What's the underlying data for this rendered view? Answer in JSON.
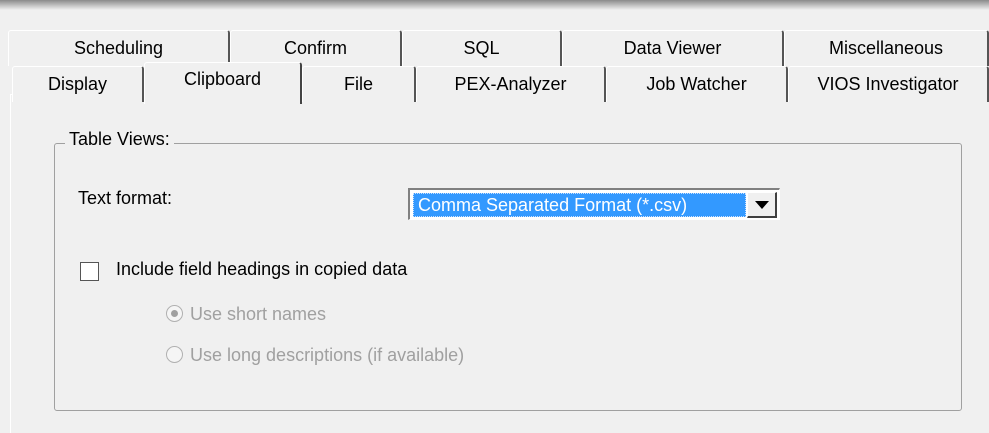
{
  "tabs_back": [
    {
      "label": "Scheduling"
    },
    {
      "label": "Confirm"
    },
    {
      "label": "SQL"
    },
    {
      "label": "Data Viewer"
    },
    {
      "label": "Miscellaneous"
    }
  ],
  "tabs_front": [
    {
      "label": "Display"
    },
    {
      "label": "Clipboard",
      "active": true
    },
    {
      "label": "File"
    },
    {
      "label": "PEX-Analyzer"
    },
    {
      "label": "Job Watcher"
    },
    {
      "label": "VIOS Investigator"
    }
  ],
  "group": {
    "title": "Table Views:",
    "text_format_label": "Text format:",
    "text_format_value": "Comma Separated Format (*.csv)",
    "include_headings_label": "Include field headings in copied data",
    "include_headings_checked": false,
    "radio_short_label": "Use short names",
    "radio_short_selected": true,
    "radio_long_label": "Use long descriptions (if available)",
    "radio_long_selected": false,
    "radios_enabled": false
  }
}
